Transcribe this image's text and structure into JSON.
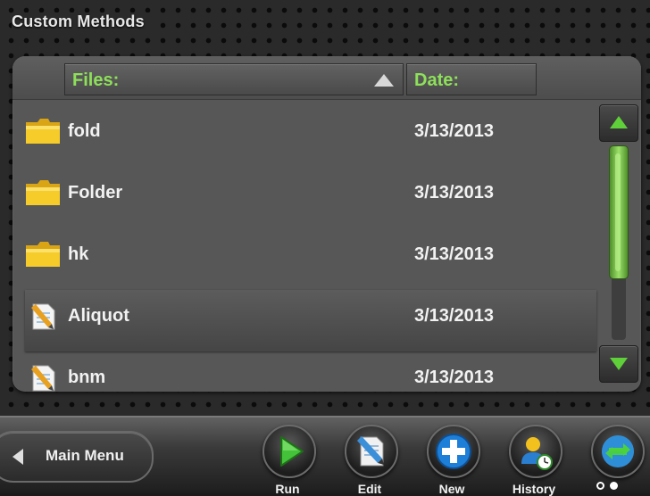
{
  "window": {
    "title": "Custom Methods"
  },
  "file_list": {
    "columns": {
      "files": "Files:",
      "date": "Date:"
    },
    "rows": [
      {
        "type": "folder",
        "name": "fold",
        "date": "3/13/2013"
      },
      {
        "type": "folder",
        "name": "Folder",
        "date": "3/13/2013"
      },
      {
        "type": "folder",
        "name": "hk",
        "date": "3/13/2013"
      },
      {
        "type": "file",
        "name": "Aliquot",
        "date": "3/13/2013",
        "selected": true
      },
      {
        "type": "file",
        "name": "bnm",
        "date": "3/13/2013"
      }
    ]
  },
  "toolbar": {
    "main_menu_label": "Main Menu",
    "run_label": "Run",
    "edit_label": "Edit",
    "new_label": "New",
    "history_label": "History"
  },
  "icons": {
    "folder": "folder-icon",
    "file": "method-file-icon",
    "run": "play-icon",
    "edit": "edit-document-icon",
    "new": "plus-icon",
    "history": "user-clock-icon",
    "sync": "sync-arrows-icon"
  },
  "colors": {
    "accent_green": "#5fcf3a",
    "header_text_green": "#8ee05a",
    "blue_button": "#1e7fd8",
    "folder_yellow": "#f2c11e"
  },
  "pagination": {
    "current_page": 2,
    "total_pages": 2
  }
}
